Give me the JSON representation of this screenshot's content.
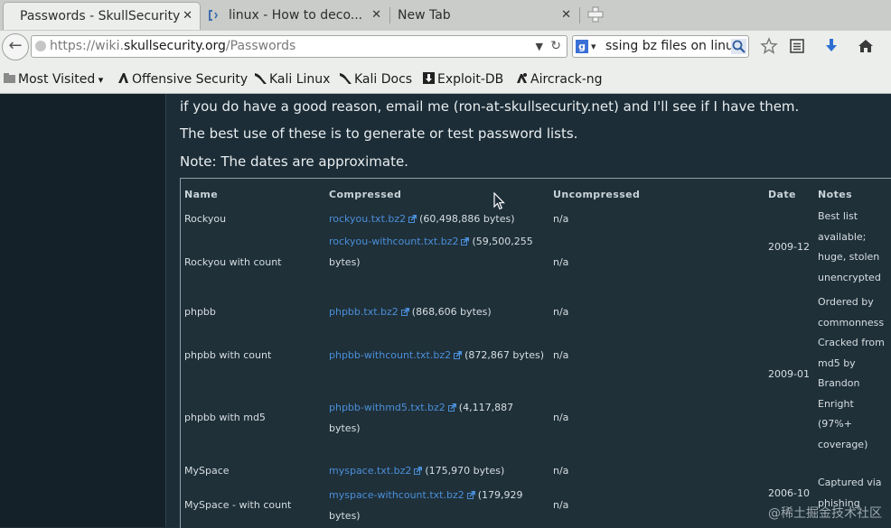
{
  "tabs": [
    {
      "title": "Passwords - SkullSecurity"
    },
    {
      "title": "linux - How to deco..."
    },
    {
      "title": "New Tab"
    }
  ],
  "nav": {
    "url_prefix": "https://wiki.",
    "url_host": "skullsecurity.org",
    "url_path": "/Passwords",
    "search_value": "ssing bz files on linux"
  },
  "bookmarks": [
    {
      "label": "Most Visited"
    },
    {
      "label": "Offensive Security"
    },
    {
      "label": "Kali Linux"
    },
    {
      "label": "Kali Docs"
    },
    {
      "label": "Exploit-DB"
    },
    {
      "label": "Aircrack-ng"
    }
  ],
  "content": {
    "line1": "if you do have a good reason, email me (ron-at-skullsecurity.net) and I'll see if I have them.",
    "line2": "The best use of these is to generate or test password lists.",
    "line3": "Note: The dates are approximate."
  },
  "table": {
    "headers": {
      "name": "Name",
      "compressed": "Compressed",
      "uncompressed": "Uncompressed",
      "date": "Date",
      "notes": "Notes"
    },
    "rows": [
      {
        "name": "Rockyou",
        "link": "rockyou.txt.bz2",
        "size_a": "(60,498,886 bytes)",
        "size_b": "",
        "uncompressed": "n/a"
      },
      {
        "name": "Rockyou with count",
        "link": "rockyou-withcount.txt.bz2",
        "size_a": "(59,500,255",
        "size_b": "bytes)",
        "uncompressed": "n/a"
      },
      {
        "name": "phpbb",
        "link": "phpbb.txt.bz2",
        "size_a": "(868,606 bytes)",
        "size_b": "",
        "uncompressed": "n/a"
      },
      {
        "name": "phpbb with count",
        "link": "phpbb-withcount.txt.bz2",
        "size_a": "(872,867 bytes)",
        "size_b": "",
        "uncompressed": "n/a"
      },
      {
        "name": "phpbb with md5",
        "link": "phpbb-withmd5.txt.bz2",
        "size_a": "(4,117,887",
        "size_b": "bytes)",
        "uncompressed": "n/a"
      },
      {
        "name": "MySpace",
        "link": "myspace.txt.bz2",
        "size_a": "(175,970 bytes)",
        "size_b": "",
        "uncompressed": "n/a"
      },
      {
        "name": "MySpace - with count",
        "link": "myspace-withcount.txt.bz2",
        "size_a": "(179,929",
        "size_b": "bytes)",
        "uncompressed": "n/a"
      }
    ],
    "groups": [
      {
        "date": "2009-12",
        "notes": [
          "Best list",
          "available;",
          "huge, stolen",
          "unencrypted"
        ]
      },
      {
        "date": "2009-01",
        "notes": [
          "Ordered by",
          "commonness",
          "Cracked from",
          "md5 by",
          "Brandon",
          "Enright",
          "(97%+",
          "coverage)"
        ]
      },
      {
        "date": "2006-10",
        "notes": [
          "Captured via",
          "phishing"
        ]
      }
    ]
  },
  "watermark": "@稀土掘金技术社区"
}
